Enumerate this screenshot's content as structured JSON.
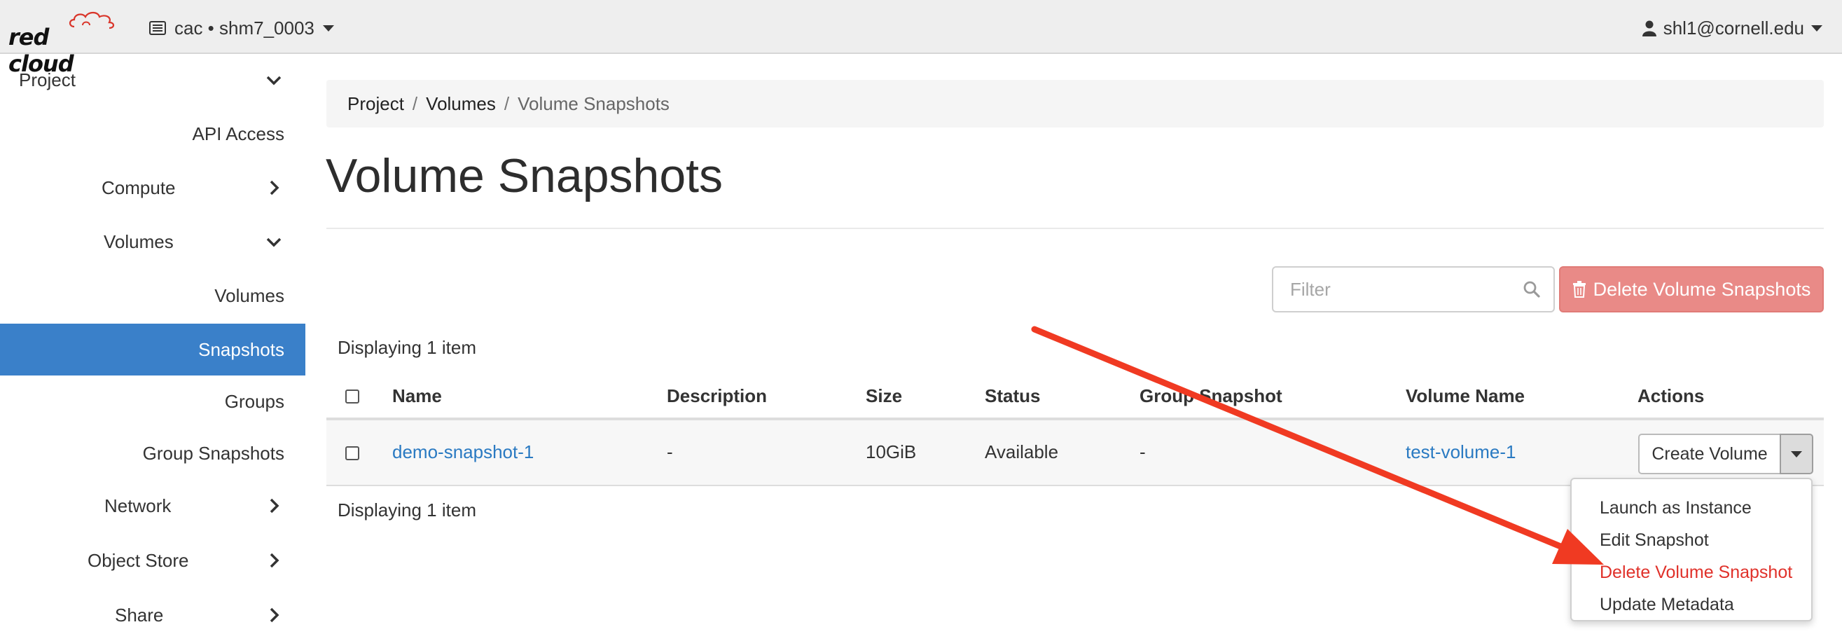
{
  "navbar": {
    "logo_text": "red cloud",
    "project_label": "cac • shm7_0003",
    "user_label": "shl1@cornell.edu"
  },
  "sidebar": {
    "items": [
      {
        "label": "Project",
        "chevron": "chevron-down-icon"
      },
      {
        "label": "API Access"
      },
      {
        "label": "Compute",
        "chevron": "chevron-right-icon"
      },
      {
        "label": "Volumes",
        "chevron": "chevron-down-icon"
      },
      {
        "label": "Volumes"
      },
      {
        "label": "Snapshots",
        "active": true
      },
      {
        "label": "Groups"
      },
      {
        "label": "Group Snapshots"
      },
      {
        "label": "Network",
        "chevron": "chevron-right-icon"
      },
      {
        "label": "Object Store",
        "chevron": "chevron-right-icon"
      },
      {
        "label": "Share",
        "chevron": "chevron-right-icon"
      }
    ],
    "active_color": "#3a80c9"
  },
  "breadcrumb": [
    "Project",
    "Volumes",
    "Volume Snapshots"
  ],
  "page_title": "Volume Snapshots",
  "toolbar": {
    "filter_placeholder": "Filter",
    "delete_label": "Delete Volume Snapshots",
    "delete_color": "#e98a87"
  },
  "table": {
    "count_top": "Displaying 1 item",
    "count_bottom": "Displaying 1 item",
    "columns": [
      "Name",
      "Description",
      "Size",
      "Status",
      "Group Snapshot",
      "Volume Name",
      "Actions"
    ],
    "rows": [
      {
        "name": "demo-snapshot-1",
        "description": "-",
        "size": "10GiB",
        "status": "Available",
        "group_snapshot": "-",
        "volume_name": "test-volume-1",
        "action": "Create Volume"
      }
    ]
  },
  "actions_menu": {
    "items": [
      "Launch as Instance",
      "Edit Snapshot",
      "Delete Volume Snapshot",
      "Update Metadata"
    ],
    "danger_color": "#e0312a"
  },
  "annotation": {
    "arrow_color": "#f03a22"
  }
}
